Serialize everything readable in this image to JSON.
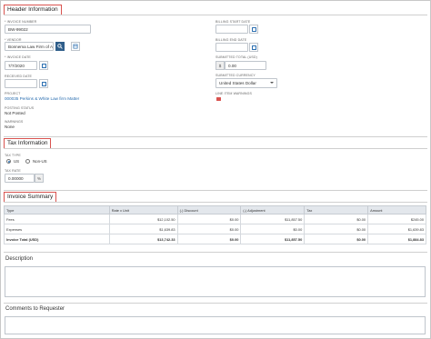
{
  "sections": {
    "header": "Header Information",
    "tax": "Tax Information",
    "invoice_summary": "Invoice Summary",
    "description": "Description",
    "comments": "Comments to Requester"
  },
  "header_fields": {
    "invoice_number_label": "* INVOICE NUMBER",
    "invoice_number_value": "BW-99022",
    "vendor_label": "* VENDOR",
    "vendor_value": "Bonnema Law Firm of A",
    "invoice_date_label": "* INVOICE DATE",
    "invoice_date_value": "7/7/2020",
    "received_date_label": "RECEIVED DATE",
    "received_date_value": "",
    "project_label": "PROJECT",
    "project_value": "000035 Perkins & White Law firm Matter",
    "posting_status_label": "POSTING STATUS",
    "posting_status_value": "Not Posted",
    "warnings_label": "WARNINGS",
    "warnings_value": "None",
    "billing_start_label": "BILLING START DATE",
    "billing_start_value": "",
    "billing_end_label": "BILLING END DATE",
    "billing_end_value": "",
    "submitted_total_label": "SUBMITTED TOTAL (USD)",
    "submitted_total_prefix": "$",
    "submitted_total_value": "0.00",
    "submitted_currency_label": "SUBMITTED CURRENCY",
    "submitted_currency_value": "United States Dollar",
    "line_item_warnings_label": "LINE ITEM WARNINGS"
  },
  "tax_fields": {
    "tax_type_label": "TAX TYPE",
    "option_us": "US",
    "option_non_us": "Non-US",
    "selected": "US",
    "tax_rate_label": "TAX RATE",
    "tax_rate_value": "0.00000",
    "tax_rate_suffix": "%"
  },
  "invoice_table": {
    "columns": [
      "Type",
      "Rate x Unit",
      "(-) Discount",
      "(-) Adjustment",
      "Tax",
      "Amount"
    ],
    "rows": [
      [
        "Fees",
        "$12,102.50",
        "$0.00",
        "$11,857.50",
        "$0.00",
        "$245.00"
      ],
      [
        "Expenses",
        "$1,639.83",
        "$0.00",
        "$0.00",
        "$0.00",
        "$1,639.83"
      ]
    ],
    "total": [
      "Invoice Total (USD)",
      "$13,742.33",
      "$0.00",
      "$11,857.50",
      "$0.00",
      "$1,884.83"
    ]
  },
  "icons": {
    "calendar": "calendar-icon",
    "search": "search-icon",
    "vendor_detail": "building-icon",
    "dropdown": "chevron-down-icon"
  },
  "colors": {
    "section_outline": "#d9534f",
    "link": "#2a6eb0",
    "button_dark": "#2f5e8a",
    "table_header": "#e3e7ec"
  }
}
